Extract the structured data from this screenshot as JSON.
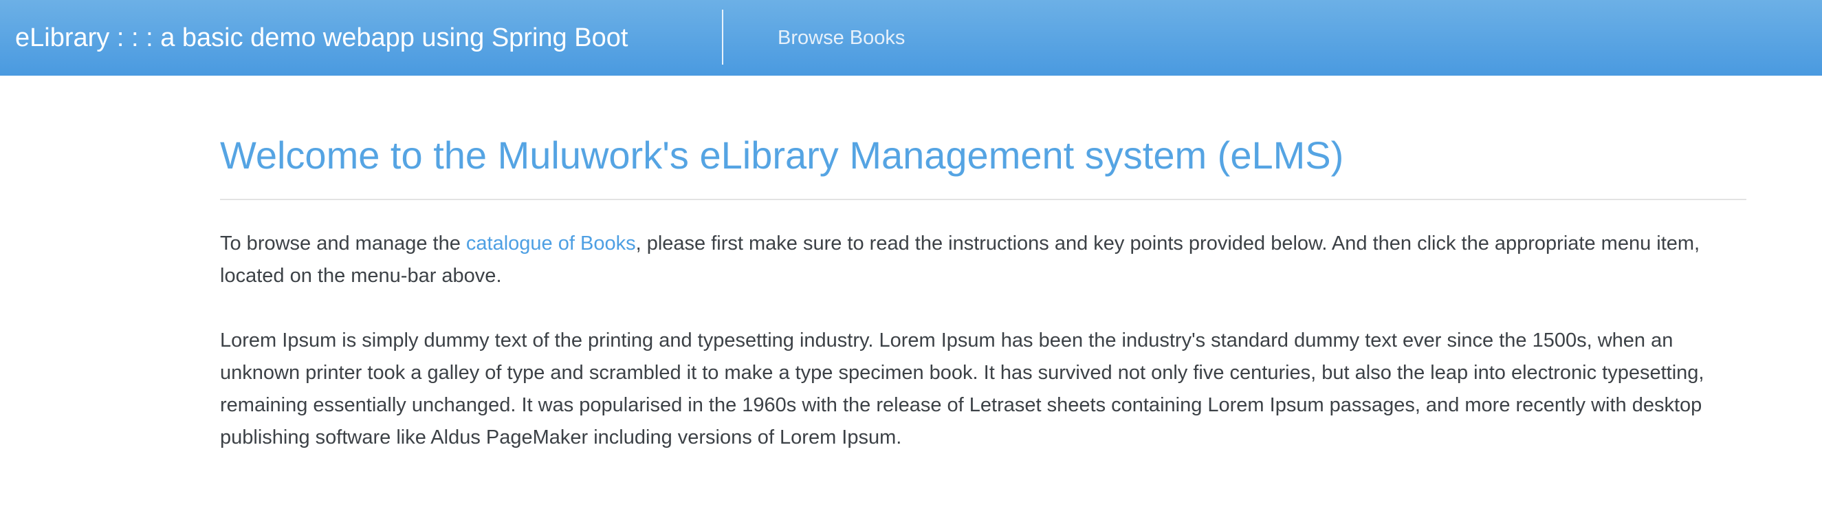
{
  "navbar": {
    "brand": "eLibrary : : : a basic demo webapp using Spring Boot",
    "links": [
      {
        "label": "Browse Books"
      }
    ]
  },
  "main": {
    "title": "Welcome to the Muluwork's eLibrary Management system (eLMS)",
    "intro": {
      "before": "To browse and manage the ",
      "link": "catalogue of Books",
      "after": ", please first make sure to read the instructions and key points provided below. And then click the appropriate menu item, located on the menu-bar above."
    },
    "lorem": "Lorem Ipsum is simply dummy text of the printing and typesetting industry. Lorem Ipsum has been the industry's standard dummy text ever since the 1500s, when an unknown printer took a galley of type and scrambled it to make a type specimen book. It has survived not only five centuries, but also the leap into electronic typesetting, remaining essentially unchanged. It was popularised in the 1960s with the release of Letraset sheets containing Lorem Ipsum passages, and more recently with desktop publishing software like Aldus PageMaker including versions of Lorem Ipsum."
  }
}
